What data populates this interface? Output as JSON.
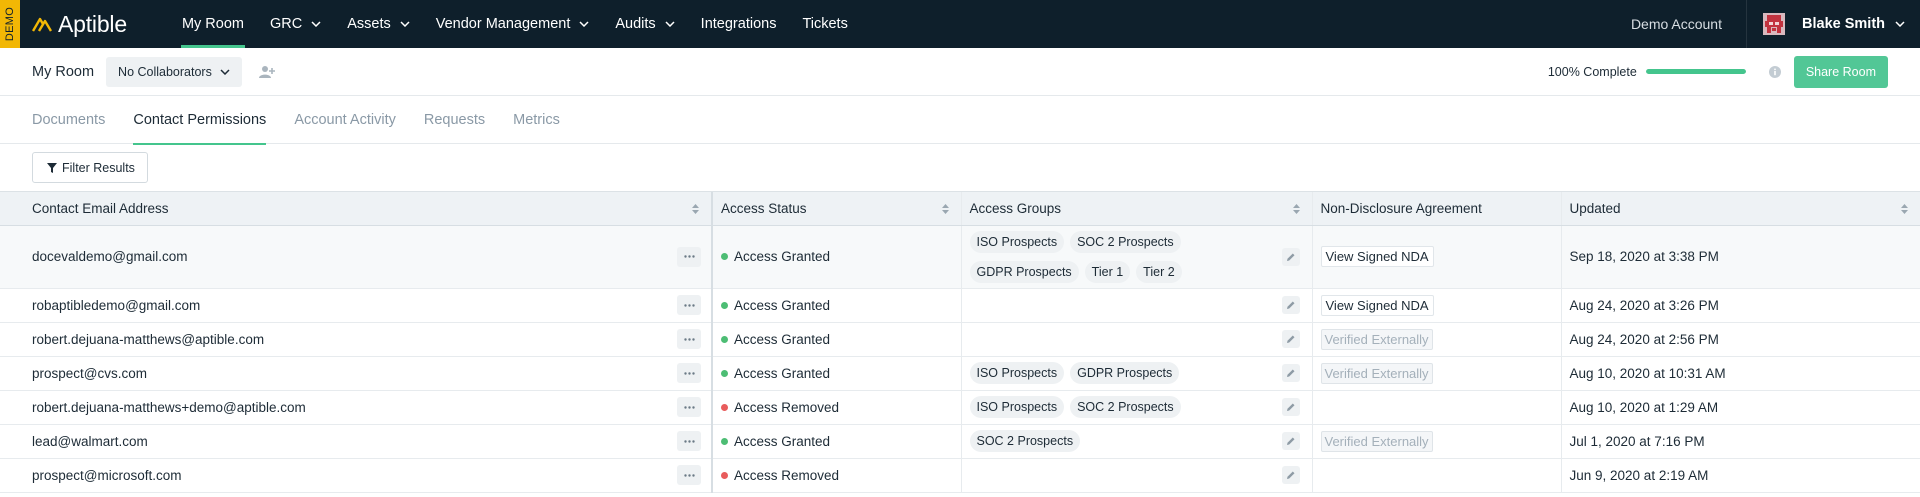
{
  "demo_badge": "DEMO",
  "brand": {
    "name": "Aptible",
    "accent": "#44c58d",
    "nav_bg": "#0e1f2b",
    "badge_color": "#f2b705"
  },
  "nav": {
    "items": [
      {
        "label": "My Room",
        "dropdown": false,
        "active": true
      },
      {
        "label": "GRC",
        "dropdown": true
      },
      {
        "label": "Assets",
        "dropdown": true
      },
      {
        "label": "Vendor Management",
        "dropdown": true
      },
      {
        "label": "Audits",
        "dropdown": true
      },
      {
        "label": "Integrations",
        "dropdown": false
      },
      {
        "label": "Tickets",
        "dropdown": false
      }
    ],
    "account_label": "Demo Account",
    "user_name": "Blake Smith"
  },
  "room": {
    "title": "My Room",
    "collaborators_label": "No Collaborators",
    "progress_label": "100% Complete",
    "progress_fraction": 1.0,
    "share_label": "Share Room"
  },
  "tabs": [
    {
      "label": "Documents",
      "active": false
    },
    {
      "label": "Contact Permissions",
      "active": true
    },
    {
      "label": "Account Activity",
      "active": false
    },
    {
      "label": "Requests",
      "active": false
    },
    {
      "label": "Metrics",
      "active": false
    }
  ],
  "filter_label": "Filter Results",
  "table": {
    "columns": {
      "email": "Contact Email Address",
      "status": "Access Status",
      "groups": "Access Groups",
      "nda": "Non-Disclosure Agreement",
      "updated": "Updated"
    },
    "status_colors": {
      "granted": "#4dbd74",
      "removed": "#e85c5c"
    },
    "rows": [
      {
        "email": "docevaldemo@gmail.com",
        "status": "Access Granted",
        "status_kind": "granted",
        "groups": [
          "ISO Prospects",
          "SOC 2 Prospects",
          "GDPR Prospects",
          "Tier 1",
          "Tier 2"
        ],
        "nda": "View Signed NDA",
        "nda_kind": "signed",
        "updated": "Sep 18, 2020 at 3:38 PM"
      },
      {
        "email": "robaptibledemo@gmail.com",
        "status": "Access Granted",
        "status_kind": "granted",
        "groups": [],
        "nda": "View Signed NDA",
        "nda_kind": "signed",
        "updated": "Aug 24, 2020 at 3:26 PM"
      },
      {
        "email": "robert.dejuana-matthews@aptible.com",
        "status": "Access Granted",
        "status_kind": "granted",
        "groups": [],
        "nda": "Verified Externally",
        "nda_kind": "external",
        "updated": "Aug 24, 2020 at 2:56 PM"
      },
      {
        "email": "prospect@cvs.com",
        "status": "Access Granted",
        "status_kind": "granted",
        "groups": [
          "ISO Prospects",
          "GDPR Prospects"
        ],
        "nda": "Verified Externally",
        "nda_kind": "external",
        "updated": "Aug 10, 2020 at 10:31 AM"
      },
      {
        "email": "robert.dejuana-matthews+demo@aptible.com",
        "status": "Access Removed",
        "status_kind": "removed",
        "groups": [
          "ISO Prospects",
          "SOC 2 Prospects"
        ],
        "nda": "",
        "nda_kind": "none",
        "updated": "Aug 10, 2020 at 1:29 AM"
      },
      {
        "email": "lead@walmart.com",
        "status": "Access Granted",
        "status_kind": "granted",
        "groups": [
          "SOC 2 Prospects"
        ],
        "nda": "Verified Externally",
        "nda_kind": "external",
        "updated": "Jul 1, 2020 at 7:16 PM"
      },
      {
        "email": "prospect@microsoft.com",
        "status": "Access Removed",
        "status_kind": "removed",
        "groups": [],
        "nda": "",
        "nda_kind": "none",
        "updated": "Jun 9, 2020 at 2:19 AM"
      }
    ]
  }
}
